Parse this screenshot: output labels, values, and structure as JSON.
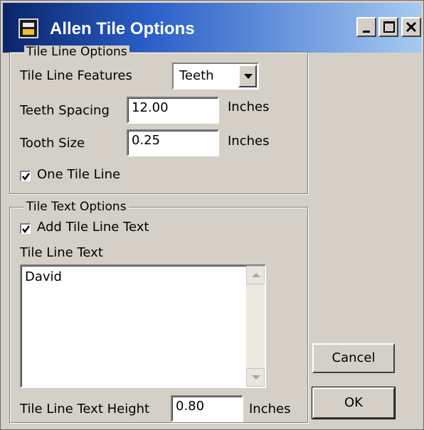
{
  "window": {
    "title": "Allen Tile Options",
    "icon": "app-icon"
  },
  "tile_line_options": {
    "group_label": "Tile Line Options",
    "features_label": "Tile Line Features",
    "features_value": "Teeth",
    "teeth_spacing_label": "Teeth Spacing",
    "teeth_spacing_value": "12.00",
    "teeth_spacing_unit": "Inches",
    "tooth_size_label": "Tooth Size",
    "tooth_size_value": "0.25",
    "tooth_size_unit": "Inches",
    "one_tile_line_label": "One Tile Line",
    "one_tile_line_checked": true
  },
  "tile_text_options": {
    "group_label": "Tile Text Options",
    "add_text_label": "Add Tile Line Text",
    "add_text_checked": true,
    "text_label": "Tile Line Text",
    "text_value": "David",
    "text_height_label": "Tile Line Text Height",
    "text_height_value": "0.80",
    "text_height_unit": "Inches"
  },
  "buttons": {
    "cancel": "Cancel",
    "ok": "OK"
  },
  "colors": {
    "title_bar_start": "#0a246a",
    "title_bar_end": "#a6caf0",
    "dialog_bg": "#d4d0c8"
  }
}
